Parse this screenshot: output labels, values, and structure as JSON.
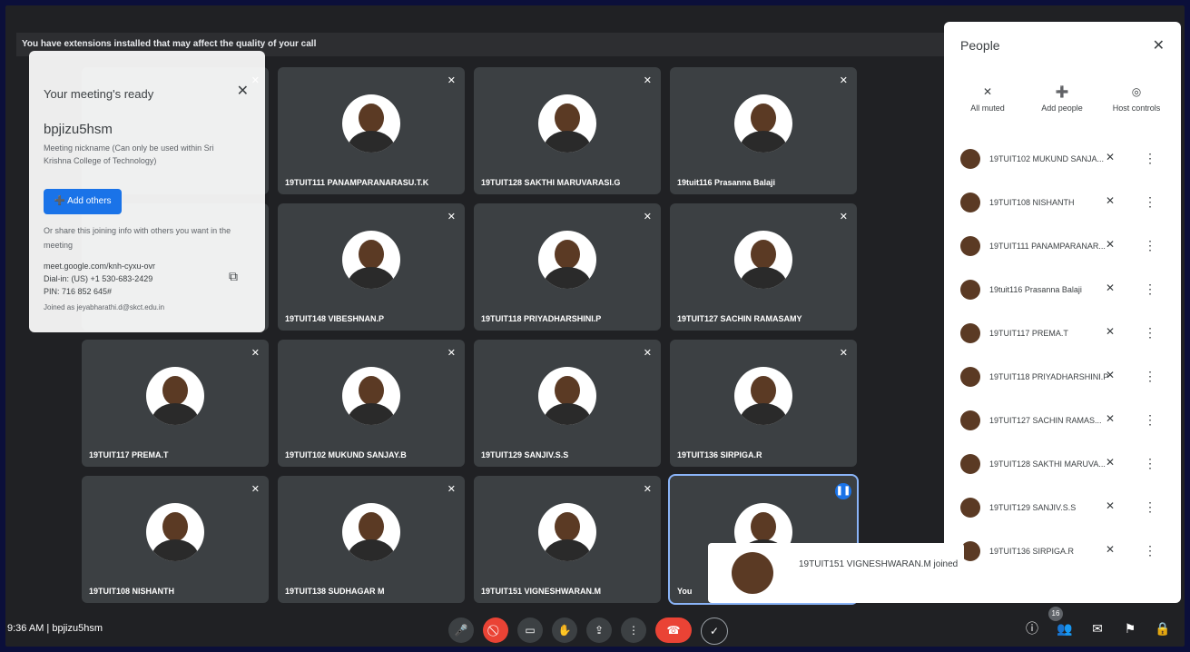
{
  "header": {
    "extension_warning": "You have extensions installed that may affect the quality of your call"
  },
  "tiles": [
    {
      "name": "19TUIT111 PANAMPARANARASU.T.K"
    },
    {
      "name": "19TUIT128 SAKTHI MARUVARASI.G"
    },
    {
      "name": "19tuit116 Prasanna Balaji"
    },
    {
      "name": "19TUIT148 VIBESHNAN.P"
    },
    {
      "name": "19TUIT118 PRIYADHARSHINI.P"
    },
    {
      "name": "19TUIT127 SACHIN RAMASAMY"
    },
    {
      "name": "19TUIT117 PREMA.T"
    },
    {
      "name": "19TUIT102 MUKUND SANJAY.B"
    },
    {
      "name": "19TUIT129 SANJIV.S.S"
    },
    {
      "name": "19TUIT136 SIRPIGA.R"
    },
    {
      "name": "19TUIT108 NISHANTH"
    },
    {
      "name": "19TUIT138 SUDHAGAR M"
    },
    {
      "name": "19TUIT151 VIGNESHWARAN.M"
    },
    {
      "name": "You"
    }
  ],
  "ready_dialog": {
    "title": "Your meeting's ready",
    "code": "bpjizu5hsm",
    "nickname_note": "Meeting nickname (Can only be used within Sri Krishna College of Technology)",
    "add_others": "Add others",
    "share_text": "Or share this joining info with others you want in the meeting",
    "link": "meet.google.com/knh-cyxu-ovr",
    "dial_in": "Dial-in: (US) +1 530-683-2429",
    "pin": "PIN: 716 852 645#",
    "joined_as": "Joined as jeyabharathi.d@skct.edu.in"
  },
  "people_panel": {
    "title": "People",
    "controls": [
      "All muted",
      "Add people",
      "Host controls"
    ],
    "participants": [
      "19TUIT102 MUKUND SANJA...",
      "19TUIT108 NISHANTH",
      "19TUIT111 PANAMPARANAR...",
      "19tuit116 Prasanna Balaji",
      "19TUIT117 PREMA.T",
      "19TUIT118 PRIYADHARSHINI.P",
      "19TUIT127 SACHIN RAMAS...",
      "19TUIT128 SAKTHI MARUVA...",
      "19TUIT129 SANJIV.S.S",
      "19TUIT136 SIRPIGA.R"
    ]
  },
  "toast": {
    "text": "19TUIT151 VIGNESHWARAN.M joined"
  },
  "bottom_bar": {
    "time": "9:36 AM",
    "separator": "|",
    "meeting_code": "bpjizu5hsm",
    "participant_count": "16"
  }
}
